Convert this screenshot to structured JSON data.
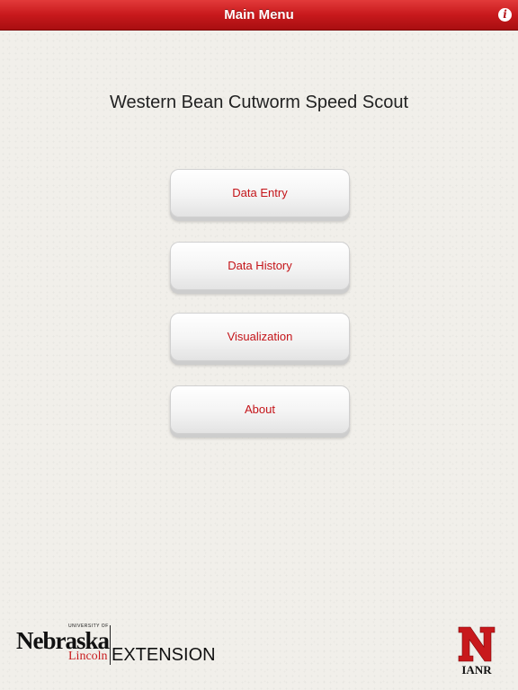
{
  "navbar": {
    "title": "Main Menu",
    "info_label": "i"
  },
  "app_title": "Western Bean Cutworm Speed Scout",
  "menu": {
    "data_entry": "Data Entry",
    "data_history": "Data History",
    "visualization": "Visualization",
    "about": "About"
  },
  "footer": {
    "unl_logo": {
      "university": "UNIVERSITY OF",
      "nebraska": "Nebraska",
      "lincoln": "Lincoln",
      "extension": "EXTENSION"
    },
    "ianr_logo": {
      "text": "IANR"
    }
  },
  "colors": {
    "brand_red": "#c8191c",
    "background": "#f1efea"
  }
}
